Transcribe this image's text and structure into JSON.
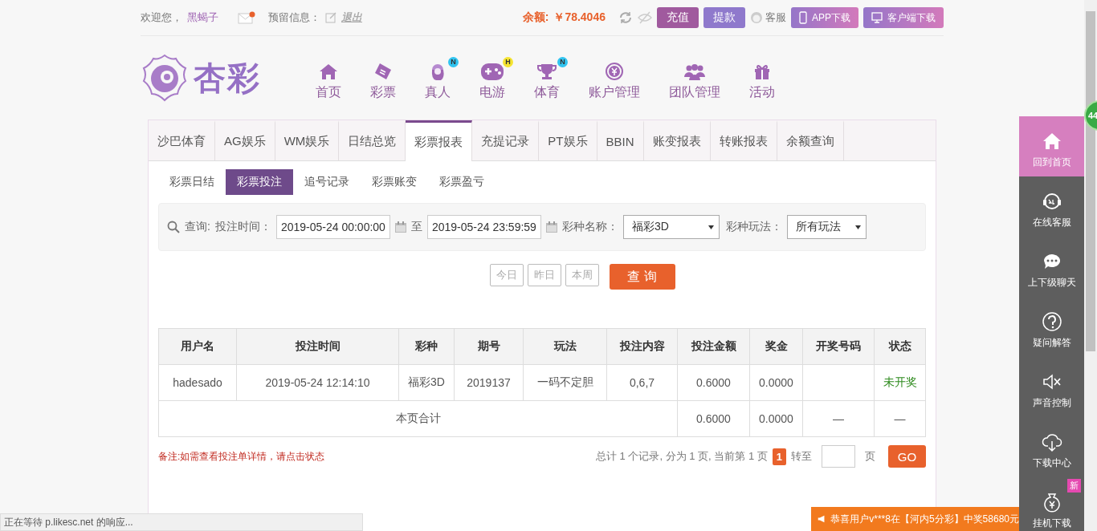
{
  "top_bar": {
    "greeting": "欢迎您，",
    "username": "黑蝎子",
    "message_label": "预留信息：",
    "logout": "退出",
    "balance_label": "余额:",
    "balance": "￥78.4046",
    "buttons": [
      {
        "label": "充值",
        "kind": "deposit"
      },
      {
        "label": "提款",
        "kind": "withdraw"
      }
    ],
    "service": "客服",
    "downloads": [
      {
        "label": "APP下载",
        "kind": "phone"
      },
      {
        "label": "客户端下载",
        "kind": "desktop"
      }
    ]
  },
  "logo": {
    "text": "杏彩"
  },
  "nav": [
    {
      "label": "首页",
      "kind": "home"
    },
    {
      "label": "彩票",
      "kind": "ticket"
    },
    {
      "label": "真人",
      "kind": "person",
      "badge": "N"
    },
    {
      "label": "电游",
      "kind": "gamepad",
      "badge": "H"
    },
    {
      "label": "体育",
      "kind": "trophy",
      "badge": "N"
    },
    {
      "label": "账户管理",
      "kind": "yen"
    },
    {
      "label": "团队管理",
      "kind": "team"
    },
    {
      "label": "活动",
      "kind": "gift"
    }
  ],
  "tabs": [
    {
      "label": "沙巴体育",
      "selected": false
    },
    {
      "label": "AG娱乐",
      "selected": false
    },
    {
      "label": "WM娱乐",
      "selected": false
    },
    {
      "label": "日结总览",
      "selected": false
    },
    {
      "label": "彩票报表",
      "selected": true
    },
    {
      "label": "充提记录",
      "selected": false
    },
    {
      "label": "PT娱乐",
      "selected": false
    },
    {
      "label": "BBIN",
      "selected": false
    },
    {
      "label": "账变报表",
      "selected": false
    },
    {
      "label": "转账报表",
      "selected": false
    },
    {
      "label": "余额查询",
      "selected": false
    }
  ],
  "subtabs": [
    {
      "label": "彩票日结",
      "selected": false
    },
    {
      "label": "彩票投注",
      "selected": true
    },
    {
      "label": "追号记录",
      "selected": false
    },
    {
      "label": "彩票账变",
      "selected": false
    },
    {
      "label": "彩票盈亏",
      "selected": false
    }
  ],
  "filter": {
    "search_label": "查询:",
    "time_label": "投注时间：",
    "start": "2019-05-24 00:00:00",
    "to": "至",
    "end": "2019-05-24 23:59:59",
    "lottery_label": "彩种名称：",
    "lottery": "福彩3D",
    "play_label": "彩种玩法：",
    "play": "所有玩法"
  },
  "quick_buttons": [
    "今日",
    "昨日",
    "本周"
  ],
  "query_button": "查 询",
  "table": {
    "columns": [
      "用户名",
      "投注时间",
      "彩种",
      "期号",
      "玩法",
      "投注内容",
      "投注金额",
      "奖金",
      "开奖号码",
      "状态"
    ],
    "rows": [
      {
        "cells": [
          "hadesado",
          "2019-05-24 12:14:10",
          "福彩3D",
          "2019137",
          "一码不定胆",
          "0,6,7",
          "0.6000",
          "0.0000",
          ""
        ],
        "status": "未开奖"
      }
    ],
    "total": {
      "label": "本页合计",
      "cells": [
        "0.6000",
        "0.0000",
        "—",
        "—"
      ]
    }
  },
  "note": "备注:如需查看投注单详情，请点击状态",
  "pagination": {
    "summary": "总计 1 个记录, 分为 1 页, 当前第 1 页",
    "current": "1",
    "goto": "转至",
    "unit": "页",
    "go": "GO"
  },
  "side_panel": [
    {
      "label": "回到首页",
      "kind": "home",
      "selected": true
    },
    {
      "label": "在线客服",
      "kind": "headset",
      "selected": false
    },
    {
      "label": "上下级聊天",
      "kind": "chat",
      "selected": false
    },
    {
      "label": "疑问解答",
      "kind": "question",
      "selected": false
    },
    {
      "label": "声音控制",
      "kind": "mute",
      "selected": false
    },
    {
      "label": "下载中心",
      "kind": "cloud",
      "selected": false
    },
    {
      "label": "挂机下载",
      "kind": "moneybag",
      "selected": false,
      "badge": "新"
    }
  ],
  "float_badge": "44",
  "status_bar": "正在等待 p.likesc.net 的响应...",
  "notice": "恭喜用户v***8在【河内5分彩】中奖58680元"
}
